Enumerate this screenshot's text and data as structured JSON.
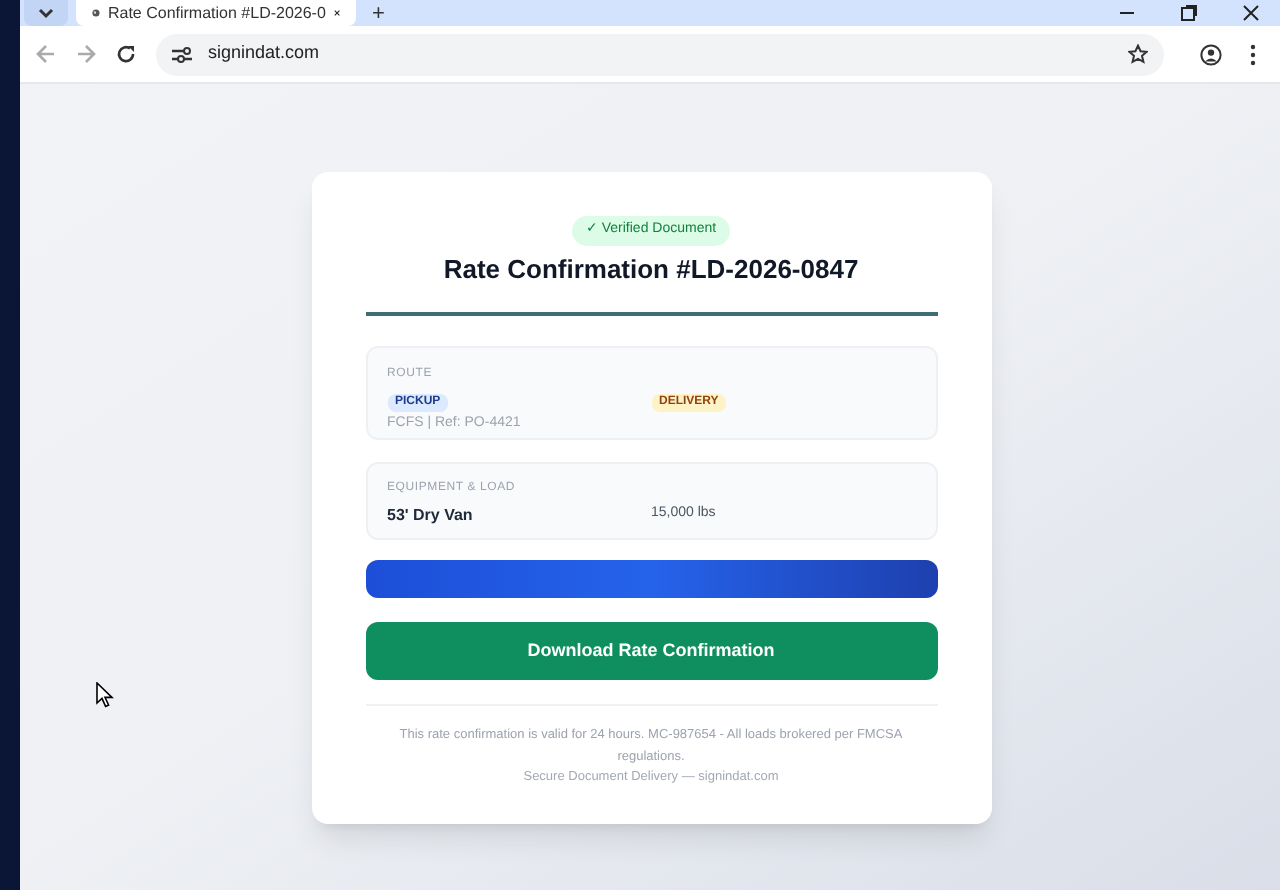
{
  "browser": {
    "tab_title": "Rate Confirmation #LD-2026-0",
    "new_tab": "+",
    "url": "signindat.com"
  },
  "card": {
    "badge": "✓ Verified Document",
    "title": "Rate Confirmation #LD-2026-0847",
    "route": {
      "label": "ROUTE",
      "pickup_tag": "PICKUP",
      "pickup_detail": "FCFS | Ref: PO-4421",
      "delivery_tag": "DELIVERY"
    },
    "equipment": {
      "label": "EQUIPMENT & LOAD",
      "type": "53' Dry Van",
      "weight": "15,000 lbs"
    },
    "download_button": "Download Rate Confirmation",
    "footer_note": "This rate confirmation is valid for 24 hours. MC-987654 - All loads brokered per FMCSA regulations.",
    "footer_brand": "Secure Document Delivery — signindat.com"
  }
}
